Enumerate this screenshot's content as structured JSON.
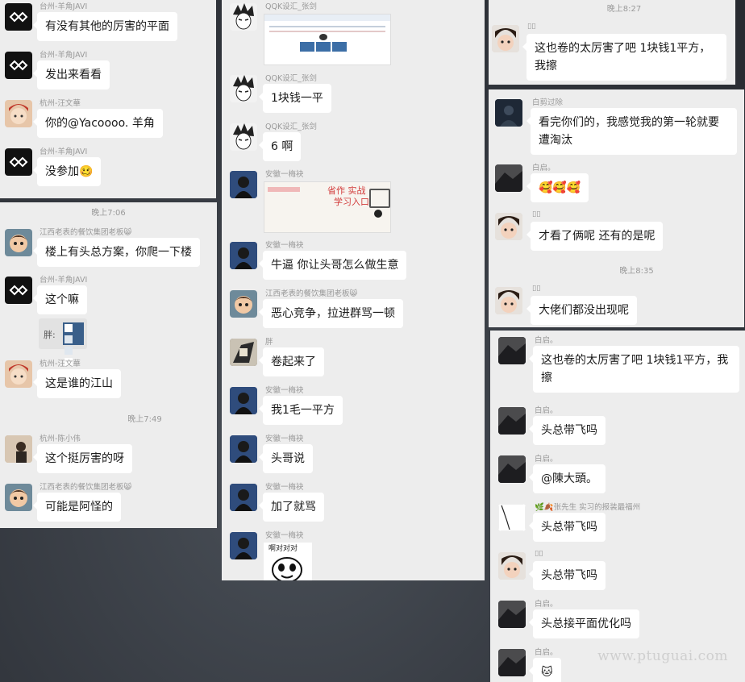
{
  "panel1": {
    "messages": [
      {
        "sender": "台州-羊角JAVI",
        "text": "有没有其他的厉害的平面"
      },
      {
        "sender": "台州-羊角JAVI",
        "text": "发出来看看"
      },
      {
        "sender": "杭州-汪文華",
        "text": "你的@Yacoooo. 羊角"
      },
      {
        "sender": "台州-羊角JAVI",
        "text": "没参加",
        "emoji": "🥴"
      }
    ]
  },
  "panel2": {
    "time1": "晚上7:06",
    "time2": "晚上7:49",
    "messages": [
      {
        "sender": "江西老表的餐饮集团老板",
        "sender_emoji": "😸",
        "text": "楼上有头总方案，你爬一下楼"
      },
      {
        "sender": "台州-羊角JAVI",
        "text": "这个嘛"
      },
      {
        "reply_prefix": "胖:"
      },
      {
        "sender": "杭州-汪文華",
        "text": "这是谁的江山"
      },
      {
        "sender": "杭州-陈小伟",
        "text": "这个挺厉害的呀"
      },
      {
        "sender": "江西老表的餐饮集团老板",
        "sender_emoji": "😸",
        "text": "可能是阿怪的"
      }
    ]
  },
  "panel3": {
    "messages": [
      {
        "sender": "QQK设汇_张剑",
        "image": "screenshot"
      },
      {
        "sender": "QQK设汇_张剑",
        "text": "1块钱一平"
      },
      {
        "sender": "QQK设汇_张剑",
        "text": "6 啊"
      },
      {
        "sender": "安徽一梅袂",
        "banner_line1": "省作 实战",
        "banner_line2": "学习入口"
      },
      {
        "sender": "安徽一梅袂",
        "text": "牛逼 你让头哥怎么做生意"
      },
      {
        "sender": "江西老表的餐饮集团老板",
        "sender_emoji": "😸",
        "text": "恶心竞争，拉进群骂一顿"
      },
      {
        "sender": "胖",
        "text": "卷起来了"
      },
      {
        "sender": "安徽一梅袂",
        "text": "我1毛一平方"
      },
      {
        "sender": "安徽一梅袂",
        "text": "头哥说"
      },
      {
        "sender": "安徽一梅袂",
        "text": "加了就骂"
      },
      {
        "sender": "安徽一梅袂",
        "sticker_text": "啊对对对"
      }
    ]
  },
  "panel4": {
    "time": "晚上8:27",
    "messages": [
      {
        "sender": "▯▯",
        "text": "这也卷的太厉害了吧 1块钱1平方，我擦"
      }
    ]
  },
  "panel5": {
    "time": "晚上8:35",
    "messages": [
      {
        "sender": "白剪过除",
        "text": "看完你们的，我感觉我的第一轮就要遭淘汰"
      },
      {
        "sender": "白启。",
        "emoji": "🥰🥰🥰"
      },
      {
        "sender": "▯▯",
        "text": "才看了俩呢 还有的是呢"
      },
      {
        "sender": "▯▯",
        "text": "大佬们都没出现呢"
      }
    ]
  },
  "panel6": {
    "messages": [
      {
        "sender": "白启。",
        "text": "这也卷的太厉害了吧 1块钱1平方，我擦"
      },
      {
        "sender": "白启。",
        "text": "头总带飞吗"
      },
      {
        "sender": "白启。",
        "text": "@陳大頭。"
      },
      {
        "sender": "🌿🍂张先生 实习的报装最福州",
        "text": "头总带飞吗"
      },
      {
        "sender": "▯▯",
        "text": "头总带飞吗"
      },
      {
        "sender": "白启。",
        "text": "头总接平面优化吗"
      },
      {
        "sender": "白启。",
        "emoji": "🐱"
      }
    ]
  },
  "watermark": "www.ptuguai.com"
}
